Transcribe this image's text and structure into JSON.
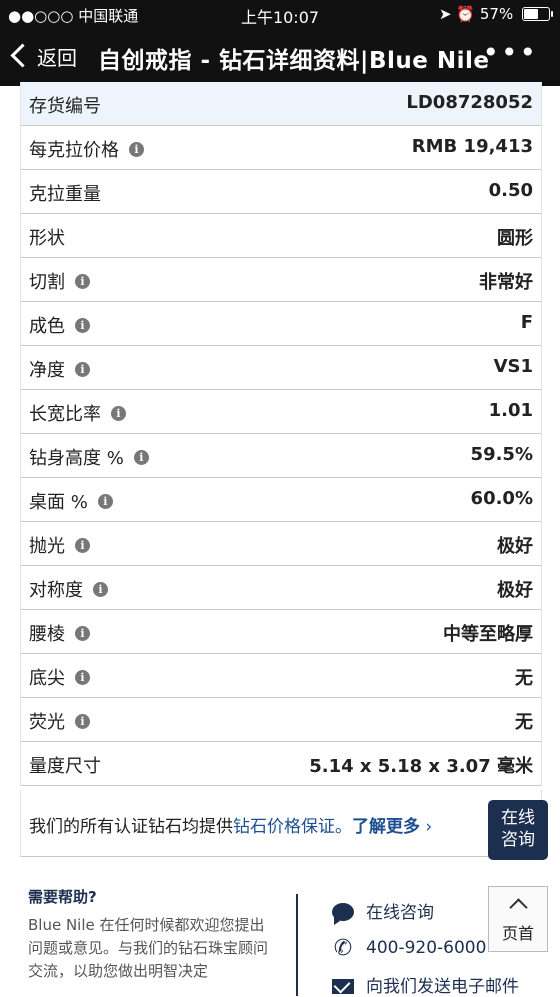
{
  "status_bar": {
    "carrier": "●●○○○ 中国联通",
    "time": "上午10:07",
    "battery": "57%",
    "battery_level": 0.57
  },
  "nav": {
    "back_label": "返回",
    "title": "自创戒指 - 钻石详细资料|Blue Nile",
    "more": "•••"
  },
  "specs": [
    {
      "label": "存货编号",
      "value": "LD08728052",
      "info": false
    },
    {
      "label": "每克拉价格",
      "value": "RMB 19,413",
      "info": true
    },
    {
      "label": "克拉重量",
      "value": "0.50",
      "info": false
    },
    {
      "label": "形状",
      "value": "圆形",
      "info": false
    },
    {
      "label": "切割",
      "value": "非常好",
      "info": true
    },
    {
      "label": "成色",
      "value": "F",
      "info": true
    },
    {
      "label": "净度",
      "value": "VS1",
      "info": true
    },
    {
      "label": "长宽比率",
      "value": "1.01",
      "info": true
    },
    {
      "label": "钻身高度 %",
      "value": "59.5%",
      "info": true
    },
    {
      "label": "桌面 %",
      "value": "60.0%",
      "info": true
    },
    {
      "label": "抛光",
      "value": "极好",
      "info": true
    },
    {
      "label": "对称度",
      "value": "极好",
      "info": true
    },
    {
      "label": "腰棱",
      "value": "中等至略厚",
      "info": true
    },
    {
      "label": "底尖",
      "value": "无",
      "info": true
    },
    {
      "label": "荧光",
      "value": "无",
      "info": true
    },
    {
      "label": "量度尺寸",
      "value": "5.14 x 5.18 x 3.07 毫米",
      "info": false
    }
  ],
  "guarantee": {
    "text": "我们的所有认证钻石均提供",
    "link1": "钻石价格保证。",
    "link2": "了解更多",
    "arrow": "›"
  },
  "chat_badge": {
    "line1": "在线",
    "line2": "咨询"
  },
  "help": {
    "title": "需要帮助?",
    "text": "Blue Nile 在任何时候都欢迎您提出问题或意见。与我们的钻石珠宝顾问交流，以助您做出明智决定",
    "contacts": [
      {
        "icon": "chat-bubble-icon",
        "label": "在线咨询"
      },
      {
        "icon": "phone-icon",
        "label": "400-920-6000"
      },
      {
        "icon": "mail-icon",
        "label": "向我们发送电子邮件"
      }
    ]
  },
  "back_to_top": {
    "label": "页首"
  },
  "colors": {
    "navy": "#1d2f4f",
    "link": "#1d4f91",
    "row_highlight": "#eef4fb"
  }
}
